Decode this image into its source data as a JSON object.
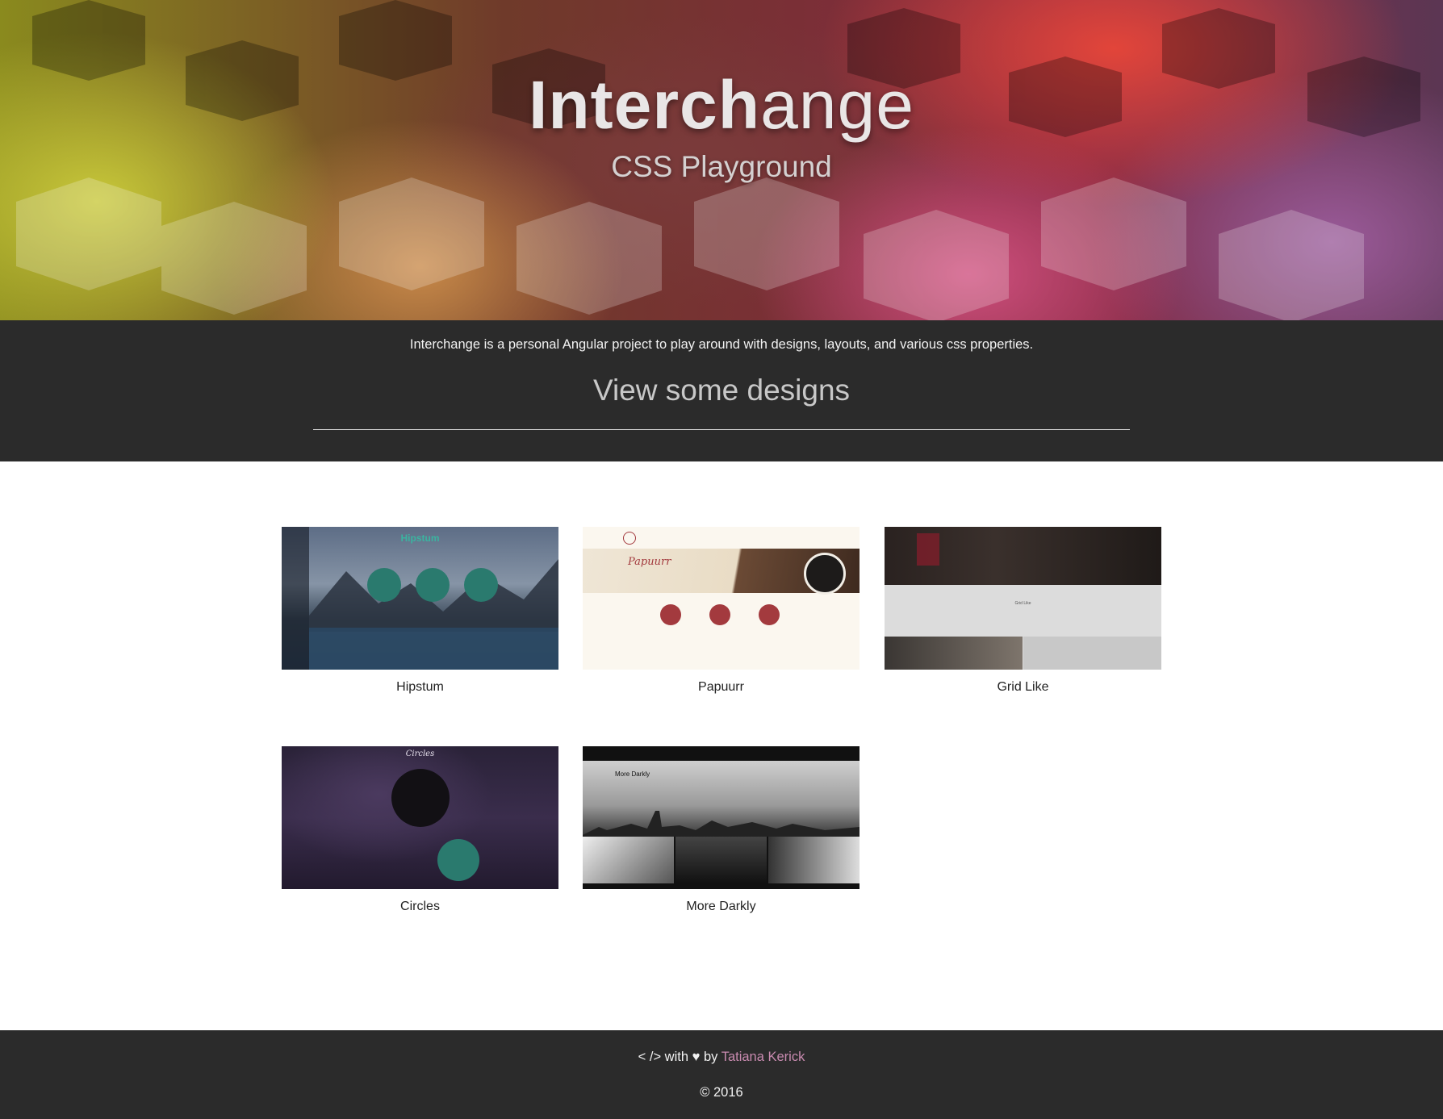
{
  "hero": {
    "title_bold": "Interch",
    "title_rest": "ange",
    "subtitle": "CSS Playground"
  },
  "intro": {
    "description": "Interchange is a personal Angular project to play around with designs, layouts, and various css properties.",
    "heading": "View some designs"
  },
  "designs": [
    {
      "label": "Hipstum",
      "thumb_title": "Hipstum"
    },
    {
      "label": "Papuurr",
      "thumb_title": "Papuurr"
    },
    {
      "label": "Grid Like",
      "thumb_title": "Grid Like"
    },
    {
      "label": "Circles",
      "thumb_title": "Circles"
    },
    {
      "label": "More Darkly",
      "thumb_title": "More Darkly"
    }
  ],
  "footer": {
    "code_glyph": "< />",
    "with_text": " with ",
    "heart": "♥",
    "by_text": " by ",
    "author": "Tatiana Kerick",
    "copyright": "© 2016"
  },
  "colors": {
    "band_bg": "#2b2b2b",
    "author_link": "#c98bb0",
    "teal_accent": "#2a7a6e",
    "papuurr_red": "#a33a3e"
  }
}
